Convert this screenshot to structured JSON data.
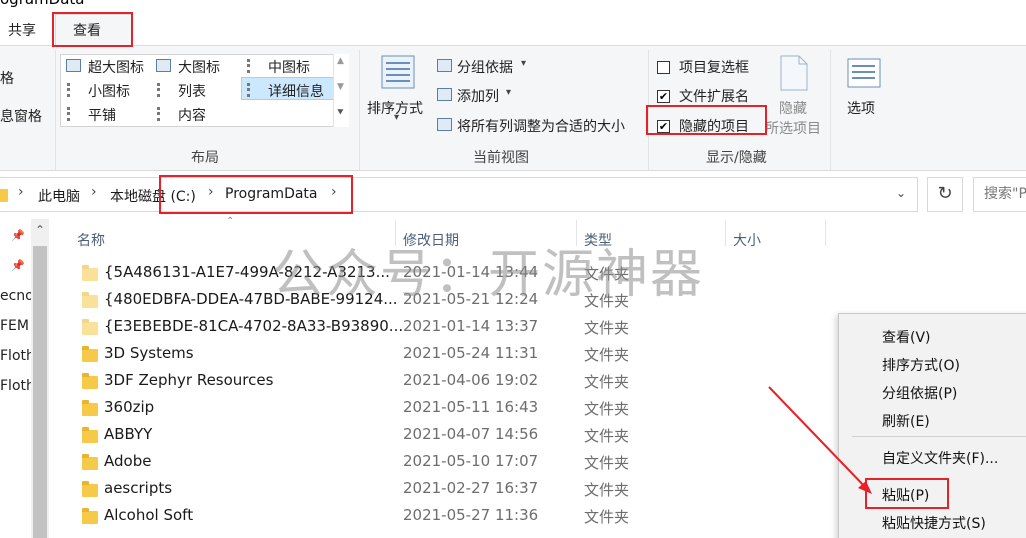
{
  "window": {
    "title_fragment": "ogramData"
  },
  "tabs": [
    {
      "label": "共享"
    },
    {
      "label": "查看"
    }
  ],
  "ribbon": {
    "left_partial": {
      "item1": "格",
      "item2": "息窗格"
    },
    "layout": {
      "group_label": "布局",
      "items": [
        {
          "label": "超大图标"
        },
        {
          "label": "大图标"
        },
        {
          "label": "中图标"
        },
        {
          "label": "小图标"
        },
        {
          "label": "列表"
        },
        {
          "label": "详细信息"
        },
        {
          "label": "平铺"
        },
        {
          "label": "内容"
        }
      ]
    },
    "current_view": {
      "group_label": "当前视图",
      "sort_label": "排序方式",
      "group_by": "分组依据",
      "add_column": "添加列",
      "fit_columns": "将所有列调整为合适的大小"
    },
    "show_hide": {
      "group_label": "显示/隐藏",
      "item_checkboxes": {
        "label": "项目复选框",
        "checked": false
      },
      "file_extensions": {
        "label": "文件扩展名",
        "checked": true
      },
      "hidden_items": {
        "label": "隐藏的项目",
        "checked": true
      },
      "hide_selected_line1": "隐藏",
      "hide_selected_line2": "所选项目"
    },
    "options_label": "选项"
  },
  "address": {
    "crumbs": [
      "此电脑",
      "本地磁盘 (C:)",
      "ProgramData"
    ],
    "search_placeholder": "搜索\"P"
  },
  "nav_pane": {
    "items": [
      "ecno",
      "FEM",
      "Floth",
      "Floth"
    ]
  },
  "columns": {
    "name": "名称",
    "date": "修改日期",
    "type": "类型",
    "size": "大小"
  },
  "files": [
    {
      "name": "{5A486131-A1E7-499A-8212-A3213...",
      "date": "2021-01-14 13:44",
      "type": "文件夹",
      "hidden": true
    },
    {
      "name": "{480EDBFA-DDEA-47BD-BABE-99124...",
      "date": "2021-05-21 12:24",
      "type": "文件夹",
      "hidden": true
    },
    {
      "name": "{E3EBEBDE-81CA-4702-8A33-B93890...",
      "date": "2021-01-14 13:37",
      "type": "文件夹",
      "hidden": true
    },
    {
      "name": "3D Systems",
      "date": "2021-05-24 11:31",
      "type": "文件夹",
      "hidden": false
    },
    {
      "name": "3DF Zephyr Resources",
      "date": "2021-04-06 19:02",
      "type": "文件夹",
      "hidden": false
    },
    {
      "name": "360zip",
      "date": "2021-05-11 16:43",
      "type": "文件夹",
      "hidden": false
    },
    {
      "name": "ABBYY",
      "date": "2021-04-07 14:56",
      "type": "文件夹",
      "hidden": false
    },
    {
      "name": "Adobe",
      "date": "2021-05-10 17:07",
      "type": "文件夹",
      "hidden": false
    },
    {
      "name": "aescripts",
      "date": "2021-02-27 16:37",
      "type": "文件夹",
      "hidden": false
    },
    {
      "name": "Alcohol Soft",
      "date": "2021-05-27 11:36",
      "type": "文件夹",
      "hidden": false
    }
  ],
  "watermark": "公众号：开源神器",
  "context_menu": {
    "items": [
      "查看(V)",
      "排序方式(O)",
      "分组依据(P)",
      "刷新(E)",
      "自定义文件夹(F)...",
      "粘贴(P)",
      "粘贴快捷方式(S)"
    ]
  },
  "colors": {
    "highlight_red": "#e5212a",
    "selection_blue": "#cce8ff",
    "folder_yellow": "#f7c948"
  }
}
